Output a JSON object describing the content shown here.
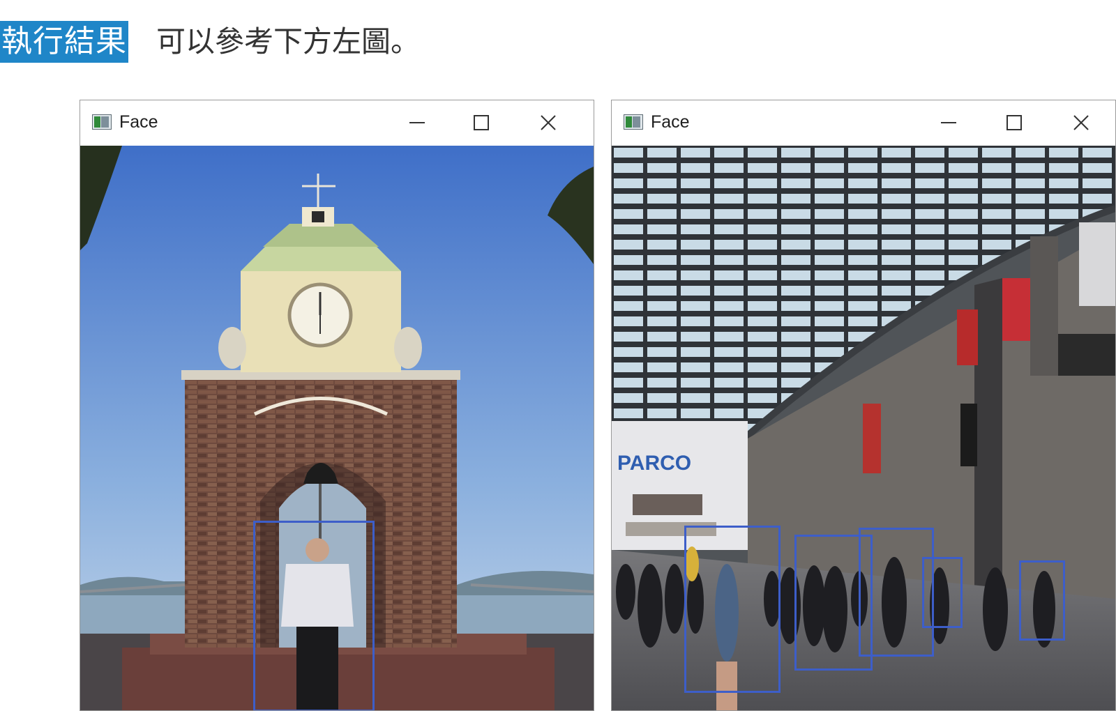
{
  "heading": {
    "tag": "執行結果",
    "caption": "可以參考下方左圖。"
  },
  "colors": {
    "tag_background": "#1f86c8",
    "detection_box": "#3d5ec9"
  },
  "windows": [
    {
      "title": "Face",
      "icon": "opencv-window-icon",
      "controls": [
        "minimize-icon",
        "maximize-icon",
        "close-icon"
      ],
      "scene": "clock tower with person under arch",
      "detections": 1
    },
    {
      "title": "Face",
      "icon": "opencv-window-icon",
      "controls": [
        "minimize-icon",
        "maximize-icon",
        "close-icon"
      ],
      "scene": "covered shopping street with pedestrians",
      "detections": 5
    }
  ],
  "signs": {
    "parco": "PARCO"
  }
}
